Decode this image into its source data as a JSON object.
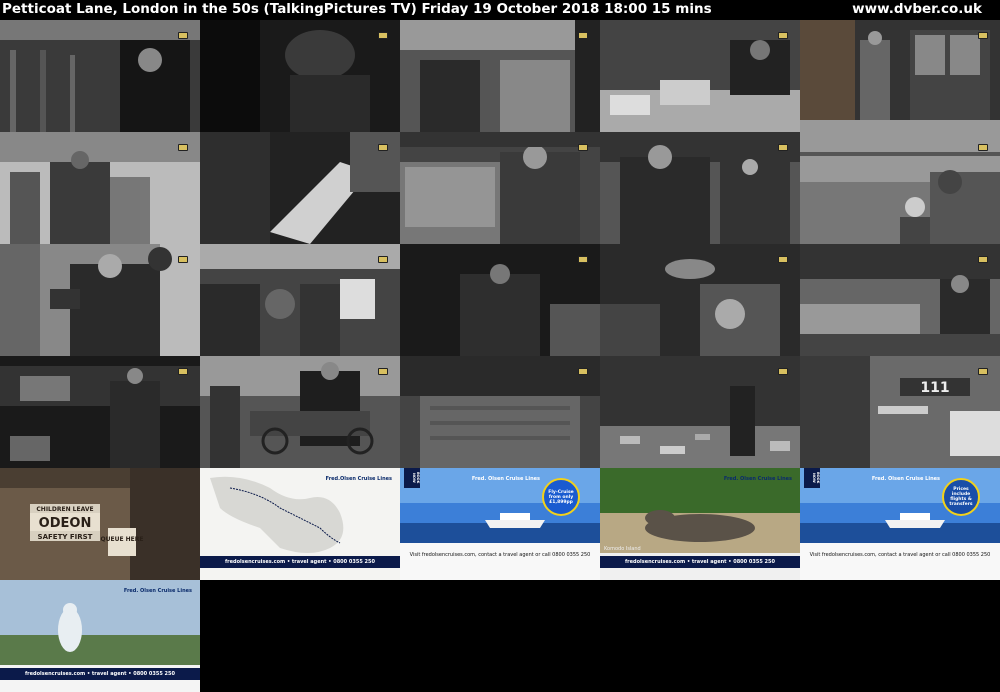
{
  "header": {
    "title": "Petticoat Lane, London in the 50s (TalkingPictures TV)    Friday 19 October 2018  18:00  15 mins",
    "url": "www.dvber.co.uk"
  },
  "colors": {
    "background": "#000000",
    "header_text": "#ffffff",
    "ad_navy": "#0b1a4a",
    "ad_sea": "#1a4ea8",
    "badge_yellow": "#f2d11a"
  },
  "thumbnails": [
    {
      "kind": "bw",
      "desc_icon": "channel-logo-icon"
    },
    {
      "kind": "bw",
      "desc_icon": "channel-logo-icon"
    },
    {
      "kind": "bw",
      "desc_icon": "channel-logo-icon"
    },
    {
      "kind": "bw",
      "desc_icon": "channel-logo-icon"
    },
    {
      "kind": "bw",
      "desc_icon": "channel-logo-icon"
    }
  ],
  "ads": {
    "map": {
      "brand": "Fred.Olsen Cruise Lines",
      "banner": "fredolsencruises.com • travel agent • 0800 0355 250"
    },
    "ship1": {
      "book_now": "BOOK NOW",
      "brand": "Fred. Olsen Cruise Lines",
      "badge": "Fly-Cruise from only £1,899pp",
      "line": "Visit fredolsencruises.com, contact a travel agent or call 0800 0355 250"
    },
    "dragon": {
      "brand": "Fred. Olsen Cruise Lines",
      "caption": "Komodo Island",
      "banner": "fredolsencruises.com • travel agent • 0800 0355 250"
    },
    "ship2": {
      "book_now": "BOOK NOW",
      "brand": "Fred. Olsen Cruise Lines",
      "badge": "Prices include flights & transfers",
      "line": "Visit fredolsencruises.com, contact a travel agent or call 0800 0355 250"
    },
    "buddha": {
      "brand": "Fred. Olsen Cruise Lines",
      "banner": "fredolsencruises.com • travel agent • 0800 0355 250"
    }
  },
  "signs": {
    "odeon": "ODEON",
    "children": "CHILDREN LEAVE",
    "safety": "SAFETY FIRST",
    "queue": "QUEUE HERE",
    "number": "111"
  }
}
